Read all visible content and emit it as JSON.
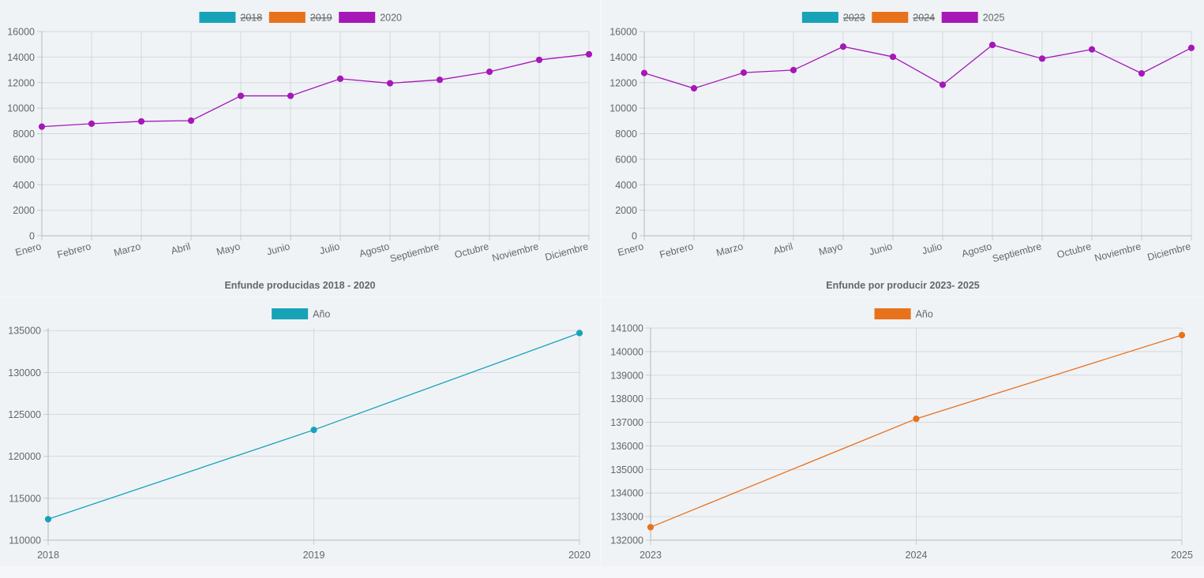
{
  "chart_data": [
    {
      "id": "top-left",
      "type": "line",
      "title": "Enfunde producidas 2018 - 2020",
      "categories": [
        "Enero",
        "Febrero",
        "Marzo",
        "Abril",
        "Mayo",
        "Junio",
        "Julio",
        "Agosto",
        "Septiembre",
        "Octubre",
        "Noviembre",
        "Diciembre"
      ],
      "legend": [
        {
          "label": "2018",
          "color": "#17a2b8",
          "hidden": true
        },
        {
          "label": "2019",
          "color": "#e8711c",
          "hidden": true
        },
        {
          "label": "2020",
          "color": "#a617b8",
          "hidden": false
        }
      ],
      "series": [
        {
          "name": "2020",
          "color": "#a617b8",
          "values": [
            8550,
            8780,
            8960,
            9020,
            10960,
            10960,
            12300,
            11950,
            12220,
            12850,
            13780,
            14220
          ]
        }
      ],
      "yticks": [
        0,
        2000,
        4000,
        6000,
        8000,
        10000,
        12000,
        14000,
        16000
      ],
      "ylim": [
        0,
        16000
      ],
      "grid": true,
      "legend_position": "top"
    },
    {
      "id": "top-right",
      "type": "line",
      "title": "Enfunde por producir 2023- 2025",
      "categories": [
        "Enero",
        "Febrero",
        "Marzo",
        "Abril",
        "Mayo",
        "Junio",
        "Julio",
        "Agosto",
        "Septiembre",
        "Octubre",
        "Noviembre",
        "Diciembre"
      ],
      "legend": [
        {
          "label": "2023",
          "color": "#17a2b8",
          "hidden": true
        },
        {
          "label": "2024",
          "color": "#e8711c",
          "hidden": true
        },
        {
          "label": "2025",
          "color": "#a617b8",
          "hidden": false
        }
      ],
      "series": [
        {
          "name": "2025",
          "color": "#a617b8",
          "values": [
            12750,
            11550,
            12780,
            12980,
            14820,
            14020,
            11830,
            14950,
            13880,
            14600,
            12720,
            14720
          ]
        }
      ],
      "yticks": [
        0,
        2000,
        4000,
        6000,
        8000,
        10000,
        12000,
        14000,
        16000
      ],
      "ylim": [
        0,
        16000
      ],
      "grid": true,
      "legend_position": "top"
    },
    {
      "id": "bottom-left",
      "type": "line",
      "categories": [
        "2018",
        "2019",
        "2020"
      ],
      "legend": [
        {
          "label": "Año",
          "color": "#17a2b8",
          "hidden": false
        }
      ],
      "series": [
        {
          "name": "Año",
          "color": "#17a2b8",
          "values": [
            112500,
            123150,
            134700
          ]
        }
      ],
      "yticks": [
        110000,
        115000,
        120000,
        125000,
        130000,
        135000
      ],
      "ylim": [
        110000,
        135300
      ],
      "grid": true,
      "legend_position": "top"
    },
    {
      "id": "bottom-right",
      "type": "line",
      "categories": [
        "2023",
        "2024",
        "2025"
      ],
      "legend": [
        {
          "label": "Año",
          "color": "#e8711c",
          "hidden": false
        }
      ],
      "series": [
        {
          "name": "Año",
          "color": "#e8711c",
          "values": [
            132550,
            137150,
            140700
          ]
        }
      ],
      "yticks": [
        132000,
        133000,
        134000,
        135000,
        136000,
        137000,
        138000,
        139000,
        140000,
        141000
      ],
      "ylim": [
        132000,
        141000
      ],
      "grid": true,
      "legend_position": "top"
    }
  ]
}
